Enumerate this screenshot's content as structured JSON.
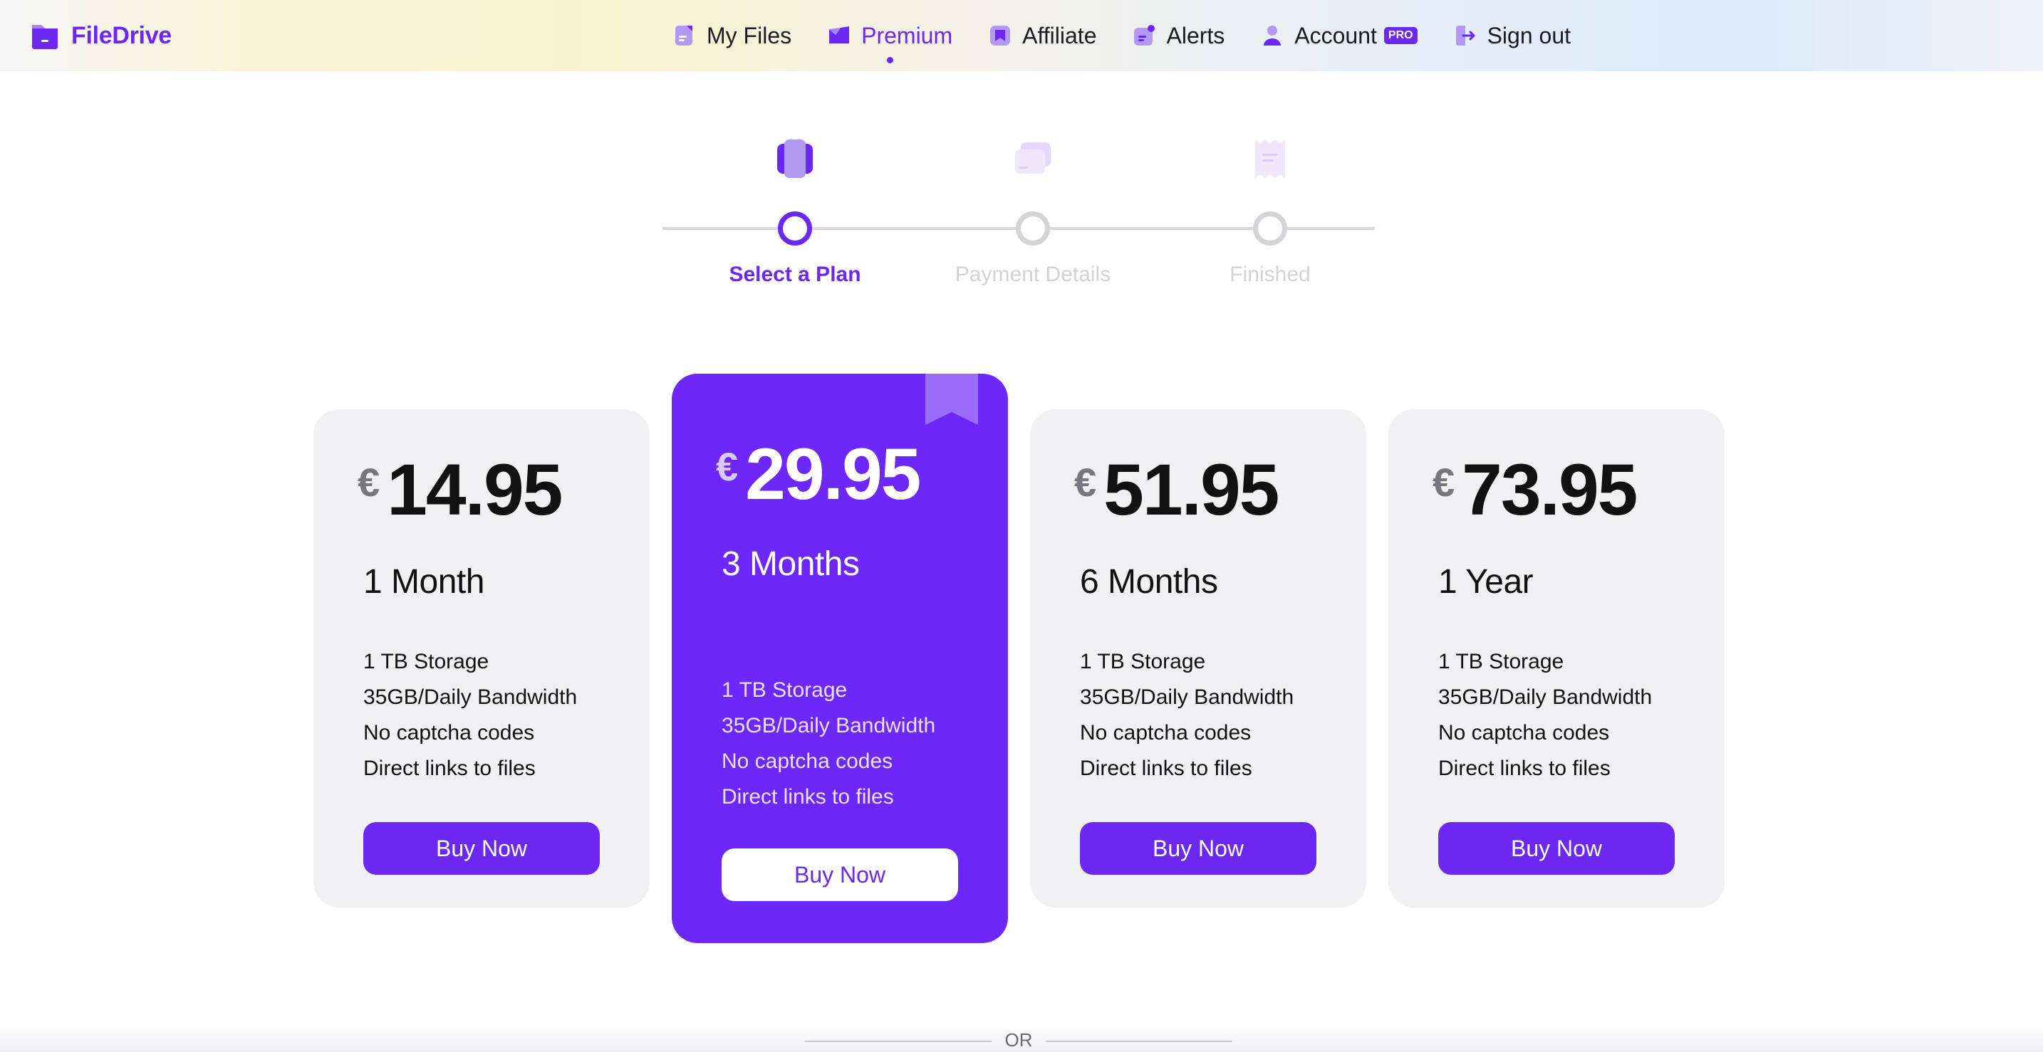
{
  "brand": {
    "name": "FileDrive",
    "icon": "folder-icon"
  },
  "nav": {
    "items": [
      {
        "label": "My Files",
        "icon": "files-icon"
      },
      {
        "label": "Premium",
        "icon": "premium-icon",
        "active": true
      },
      {
        "label": "Affiliate",
        "icon": "affiliate-icon"
      },
      {
        "label": "Alerts",
        "icon": "bell-icon"
      },
      {
        "label": "Account",
        "icon": "user-icon",
        "badge": "PRO"
      },
      {
        "label": "Sign out",
        "icon": "sign-out-icon"
      }
    ]
  },
  "stepper": {
    "steps": [
      {
        "label": "Select a Plan",
        "icon": "plan-cards-icon",
        "active": true
      },
      {
        "label": "Payment Details",
        "icon": "payment-card-icon",
        "active": false
      },
      {
        "label": "Finished",
        "icon": "receipt-icon",
        "active": false
      }
    ]
  },
  "plans": [
    {
      "currency": "€",
      "price": "14.95",
      "duration": "1 Month",
      "features": [
        "1 TB Storage",
        "35GB/Daily Bandwidth",
        "No captcha codes",
        "Direct links to files"
      ],
      "button": "Buy Now"
    },
    {
      "currency": "€",
      "price": "29.95",
      "duration": "3 Months",
      "featured": true,
      "features": [
        "1 TB Storage",
        "35GB/Daily Bandwidth",
        "No captcha codes",
        "Direct links to files"
      ],
      "button": "Buy Now"
    },
    {
      "currency": "€",
      "price": "51.95",
      "duration": "6 Months",
      "features": [
        "1 TB Storage",
        "35GB/Daily Bandwidth",
        "No captcha codes",
        "Direct links to files"
      ],
      "button": "Buy Now"
    },
    {
      "currency": "€",
      "price": "73.95",
      "duration": "1 Year",
      "features": [
        "1 TB Storage",
        "35GB/Daily Bandwidth",
        "No captcha codes",
        "Direct links to files"
      ],
      "button": "Buy Now"
    }
  ],
  "divider": {
    "text": "OR"
  },
  "colors": {
    "accent": "#6b28f0",
    "card": "#f1f1f4",
    "muted": "#d2d2d7"
  }
}
